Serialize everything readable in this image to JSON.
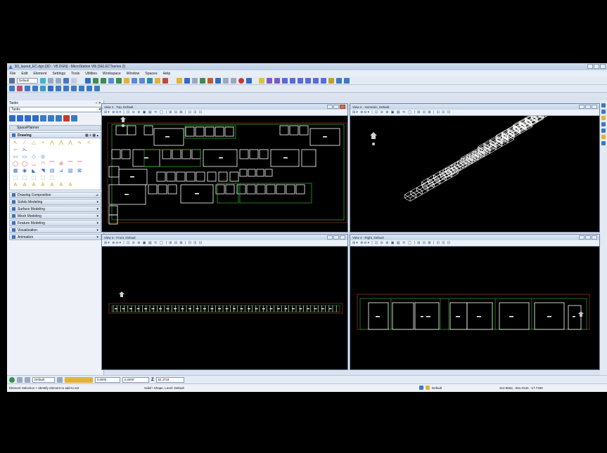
{
  "window": {
    "title": "3D_layout_EC.dgn [3D - V8 DGN] - MicroStation V8i (SELECTseries 2)"
  },
  "menu": [
    "File",
    "Edit",
    "Element",
    "Settings",
    "Tools",
    "Utilities",
    "Workspace",
    "Window",
    "Spaces",
    "Help"
  ],
  "toolbar": {
    "level_select": "Default"
  },
  "tasks": {
    "header": "Tasks",
    "dropdown": "Tasks",
    "workflow": "SpacePlanner",
    "active_section": "Drawing",
    "sections": [
      "Drawing Composition",
      "Solids Modeling",
      "Surface Modeling",
      "Mesh Modeling",
      "Feature Modeling",
      "Visualization",
      "Animation"
    ],
    "tool_glyphs": [
      "↖",
      "∕",
      "△",
      "+",
      "⋀",
      "⋀",
      "⋀",
      "∿",
      "<",
      "⌐",
      "⋋",
      "",
      "",
      "",
      "",
      "",
      "",
      "",
      "▭",
      "▭",
      "◇",
      "◎",
      "",
      "",
      "",
      "",
      "",
      "◯",
      "◯",
      "◡",
      "◠",
      "⌒",
      "⊘",
      "⌒",
      "⌒",
      "",
      "▦",
      "◉",
      "◣",
      "◥",
      "▤",
      "⊿",
      "▧",
      "⊠",
      "",
      "⬚",
      "⬚",
      "⬚",
      "⬚",
      "⬚",
      "",
      "",
      "",
      "",
      "A",
      "A",
      "A",
      "A",
      "A",
      "A",
      "A",
      "",
      ""
    ]
  },
  "views": [
    {
      "title": "View 1 - Top, Default"
    },
    {
      "title": "View 2 - Isometric, Default"
    },
    {
      "title": "View 3 - Front, Default"
    },
    {
      "title": "View 4 - Right, Default"
    }
  ],
  "status": {
    "level_select": "Default",
    "x_value": "0.0000",
    "angle_value": "0.0000°",
    "z_label": "Z",
    "z_value": "52.4718",
    "prompt": "Element Selection > Identify element to add to set",
    "element_info": "Solid \\ Shape, Level: Default",
    "level_indicator": "Default",
    "coords": "212.8562, -251.0132, -17.7400"
  },
  "colors": {
    "canvas_bg": "#000000",
    "line_white": "#ffffff",
    "line_green": "#2aa02a",
    "line_red": "#a33a2a"
  }
}
